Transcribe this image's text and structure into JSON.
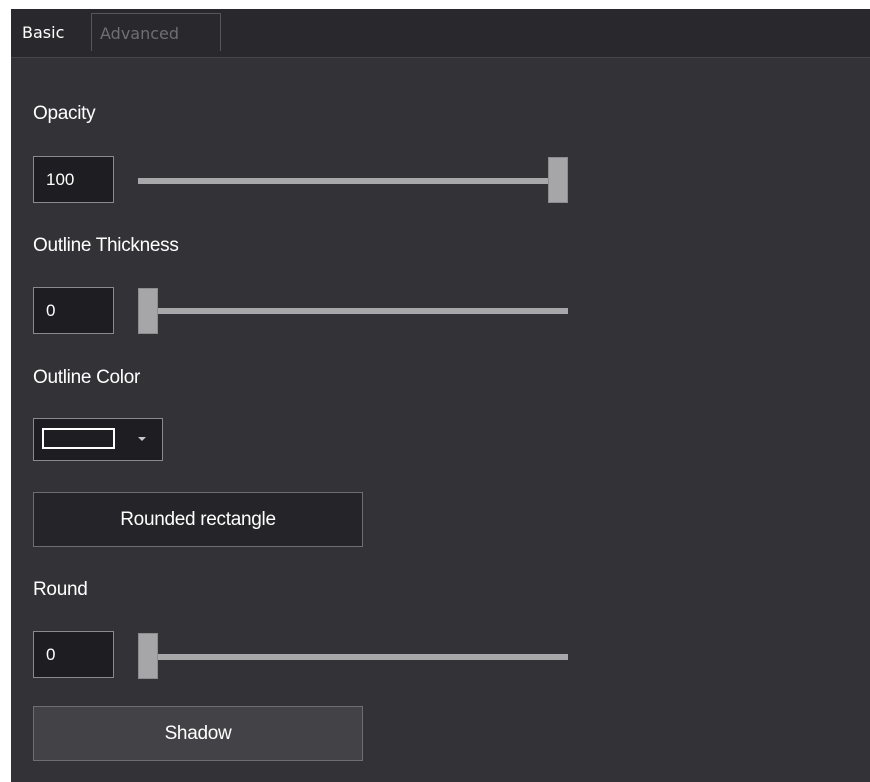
{
  "tabs": {
    "basic": "Basic",
    "advanced": "Advanced"
  },
  "opacity": {
    "label": "Opacity",
    "value": "100",
    "level": 1.0
  },
  "outline_thickness": {
    "label": "Outline Thickness",
    "value": "0",
    "level": 0.0
  },
  "outline_color": {
    "label": "Outline Color",
    "swatch_color": "#1e1d21",
    "swatch_border_color": "#ffffff",
    "dropdown_icon": "chevron-down-icon"
  },
  "shape_button": {
    "label": "Rounded rectangle"
  },
  "round": {
    "label": "Round",
    "value": "0",
    "level": 0.0
  },
  "shadow_button": {
    "label": "Shadow"
  },
  "colors": {
    "panel_background": "#333237",
    "tabstrip_background": "#29282c",
    "input_background": "#1e1d21",
    "slider_color": "#a8a8ab",
    "text": "#ffffff",
    "inactive_tab_text": "#6f6e73"
  }
}
